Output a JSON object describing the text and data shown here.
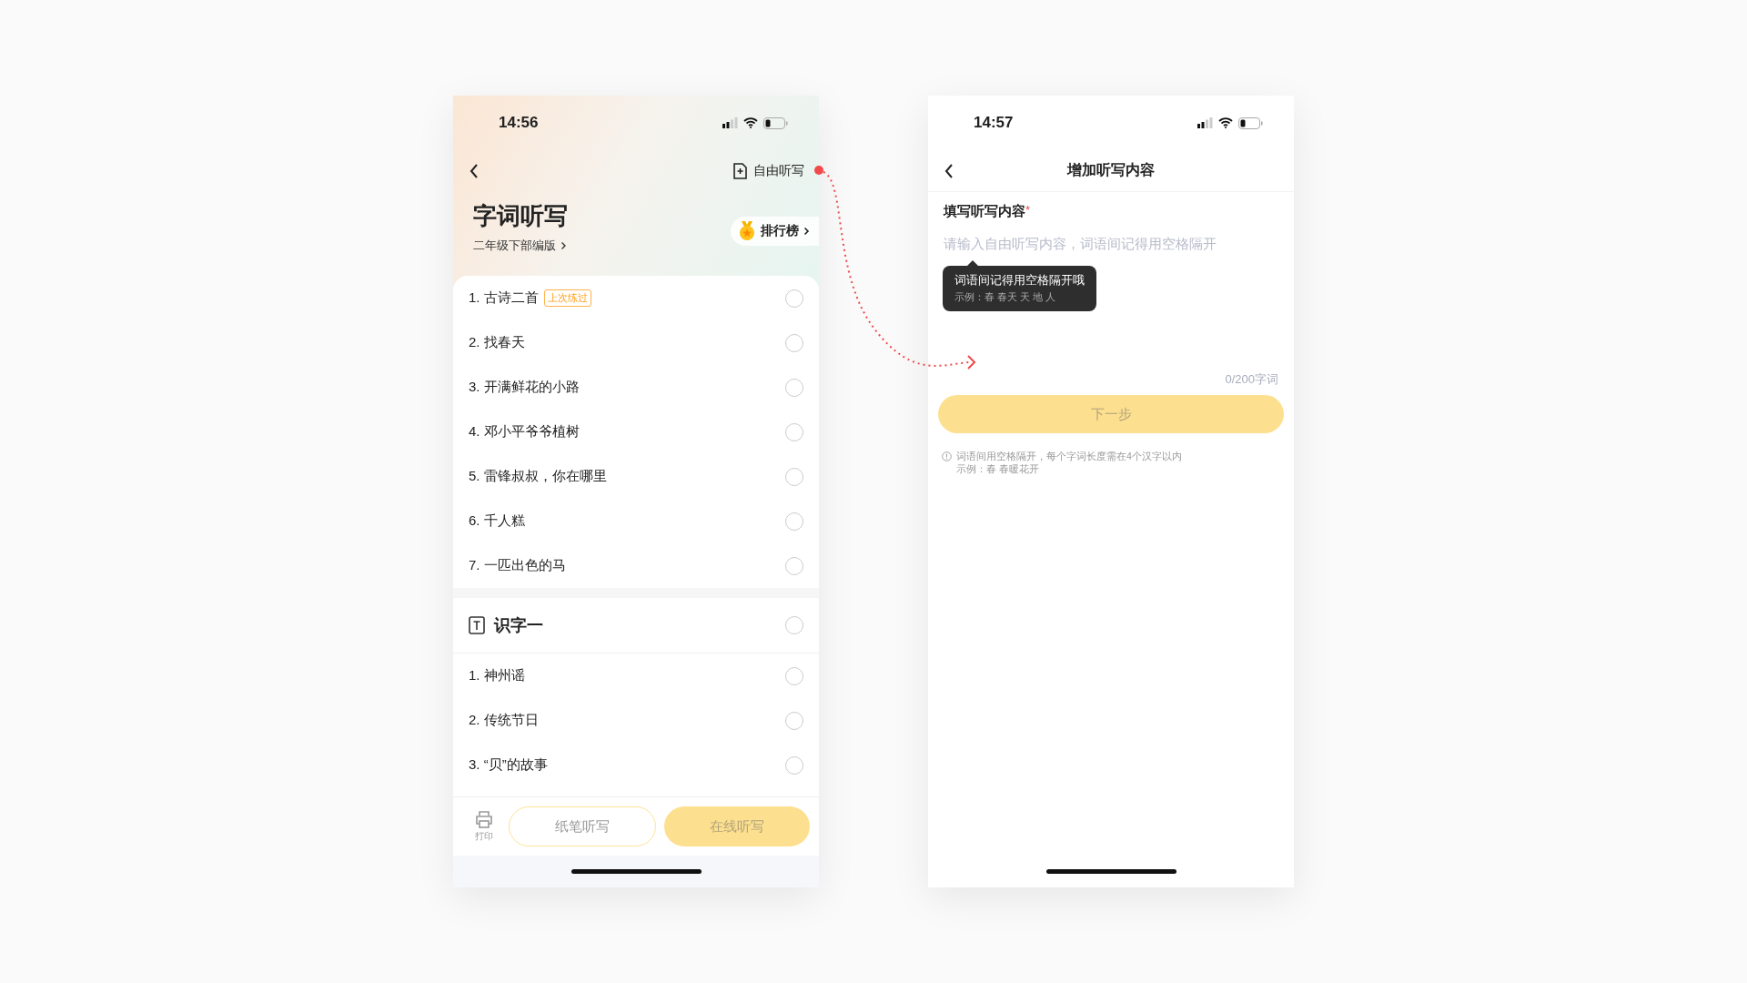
{
  "left_phone": {
    "status_bar": {
      "time": "14:56"
    },
    "free_dictation": "自由听写",
    "title": "字词听写",
    "edition": "二年级下部编版",
    "ranking": "排行榜",
    "units": [
      {
        "lessons": [
          {
            "label": "1. 古诗二首",
            "tag": "上次练过",
            "checked": false
          },
          {
            "label": "2. 找春天",
            "checked": false
          },
          {
            "label": "3. 开满鲜花的小路",
            "checked": false
          },
          {
            "label": "4. 邓小平爷爷植树",
            "checked": false
          },
          {
            "label": "5. 雷锋叔叔，你在哪里",
            "checked": false
          },
          {
            "label": "6. 千人糕",
            "checked": false
          },
          {
            "label": "7. 一匹出色的马",
            "checked": false
          }
        ]
      },
      {
        "title": "识字一",
        "checked": false,
        "lessons": [
          {
            "label": "1. 神州谣",
            "checked": false
          },
          {
            "label": "2. 传统节日",
            "checked": false
          },
          {
            "label": "3. “贝”的故事",
            "checked": false
          }
        ]
      }
    ],
    "print": "打印",
    "paper_button": "纸笔听写",
    "online_button": "在线听写"
  },
  "right_phone": {
    "status_bar": {
      "time": "14:57"
    },
    "title": "增加听写内容",
    "field_label": "填写听写内容",
    "required_mark": "*",
    "placeholder": "请输入自由听写内容，词语间记得用空格隔开",
    "tooltip": {
      "text": "词语间记得用空格隔开哦",
      "example": "示例：春 春天 天 地 人"
    },
    "counter": "0/200字词",
    "next_button": "下一步",
    "hints": [
      "词语间用空格隔开，每个字词长度需在4个汉字以内",
      "示例：春 春暖花开"
    ]
  }
}
